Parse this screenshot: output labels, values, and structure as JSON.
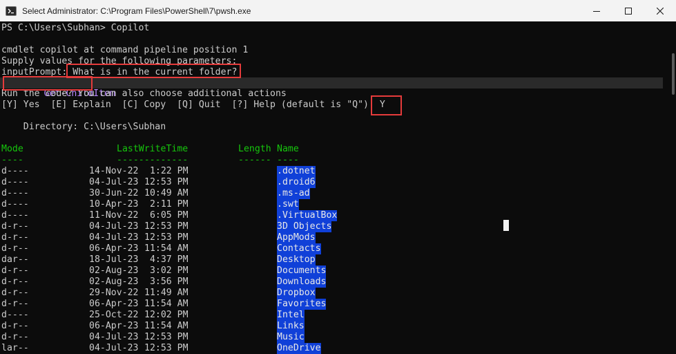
{
  "window": {
    "title": "Select Administrator: C:\\Program Files\\PowerShell\\7\\pwsh.exe",
    "icon": "powershell-icon",
    "controls": [
      "minimize-icon",
      "maximize-icon",
      "close-icon"
    ]
  },
  "colors": {
    "titlebar": "#f3f3f3",
    "terminal_bg": "#0c0c0c",
    "header_green": "#16c60c",
    "selection_blue": "#1040d8",
    "annotation_red": "#e63b3b",
    "suggestion_purple": "#b987ff"
  },
  "terminal": {
    "prompt_line": "PS C:\\Users\\Subhan> Copilot",
    "cmdlet_line": "cmdlet copilot at command pipeline position 1",
    "supply_line": "Supply values for the following parameters:",
    "input_prompt_label": "inputPrompt:",
    "input_prompt_value": " What is in the current folder?",
    "suggestion": "Get-ChildItem",
    "run_question": "Run the code? You can also choose additional actions",
    "options_line": "[Y] Yes  [E] Explain  [C] Copy  [Q] Quit  [?] Help (default is \"Q\"):",
    "answer": " Y",
    "directory_line": "    Directory: C:\\Users\\Subhan",
    "headers": {
      "mode": "Mode",
      "lastwrite": "LastWriteTime",
      "length": "Length",
      "name": "Name"
    },
    "underlines": {
      "mode": "----",
      "lastwrite": "-------------",
      "length": "------",
      "name": "----"
    },
    "rows": [
      {
        "mode": "d----",
        "date": "14-Nov-22",
        "time": " 1:22 PM",
        "name": ".dotnet"
      },
      {
        "mode": "d----",
        "date": "04-Jul-23",
        "time": "12:53 PM",
        "name": ".droid6"
      },
      {
        "mode": "d----",
        "date": "30-Jun-22",
        "time": "10:49 AM",
        "name": ".ms-ad"
      },
      {
        "mode": "d----",
        "date": "10-Apr-23",
        "time": " 2:11 PM",
        "name": ".swt"
      },
      {
        "mode": "d----",
        "date": "11-Nov-22",
        "time": " 6:05 PM",
        "name": ".VirtualBox"
      },
      {
        "mode": "d-r--",
        "date": "04-Jul-23",
        "time": "12:53 PM",
        "name": "3D Objects"
      },
      {
        "mode": "d-r--",
        "date": "04-Jul-23",
        "time": "12:53 PM",
        "name": "AppMods"
      },
      {
        "mode": "d-r--",
        "date": "06-Apr-23",
        "time": "11:54 AM",
        "name": "Contacts"
      },
      {
        "mode": "dar--",
        "date": "18-Jul-23",
        "time": " 4:37 PM",
        "name": "Desktop"
      },
      {
        "mode": "d-r--",
        "date": "02-Aug-23",
        "time": " 3:02 PM",
        "name": "Documents"
      },
      {
        "mode": "d-r--",
        "date": "02-Aug-23",
        "time": " 3:56 PM",
        "name": "Downloads"
      },
      {
        "mode": "d-r--",
        "date": "29-Nov-22",
        "time": "11:49 AM",
        "name": "Dropbox"
      },
      {
        "mode": "d-r--",
        "date": "06-Apr-23",
        "time": "11:54 AM",
        "name": "Favorites"
      },
      {
        "mode": "d----",
        "date": "25-Oct-22",
        "time": "12:02 PM",
        "name": "Intel"
      },
      {
        "mode": "d-r--",
        "date": "06-Apr-23",
        "time": "11:54 AM",
        "name": "Links"
      },
      {
        "mode": "d-r--",
        "date": "04-Jul-23",
        "time": "12:53 PM",
        "name": "Music"
      },
      {
        "mode": "lar--",
        "date": "04-Jul-23",
        "time": "12:53 PM",
        "name": "OneDrive"
      }
    ]
  }
}
